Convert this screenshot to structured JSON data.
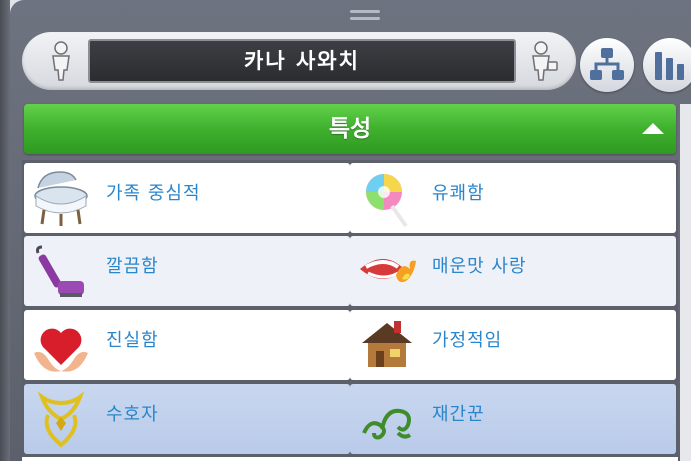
{
  "header": {
    "sim_name": "카나 사와치"
  },
  "section": {
    "title": "특성"
  },
  "traits": [
    {
      "label": "가족 중심적",
      "icon": "bassinet-icon"
    },
    {
      "label": "유쾌함",
      "icon": "lollipop-icon"
    },
    {
      "label": "깔끔함",
      "icon": "vacuum-icon"
    },
    {
      "label": "매운맛 사랑",
      "icon": "fiery-mouth-icon"
    },
    {
      "label": "진실함",
      "icon": "heart-hands-icon"
    },
    {
      "label": "가정적임",
      "icon": "house-icon"
    },
    {
      "label": "수호자",
      "icon": "guardian-emblem-icon"
    },
    {
      "label": "재간꾼",
      "icon": "green-swirl-icon"
    }
  ],
  "colors": {
    "accent_green": "#3fb02e",
    "label_blue": "#2a86cc",
    "selected_row": "#c0d0ec"
  }
}
